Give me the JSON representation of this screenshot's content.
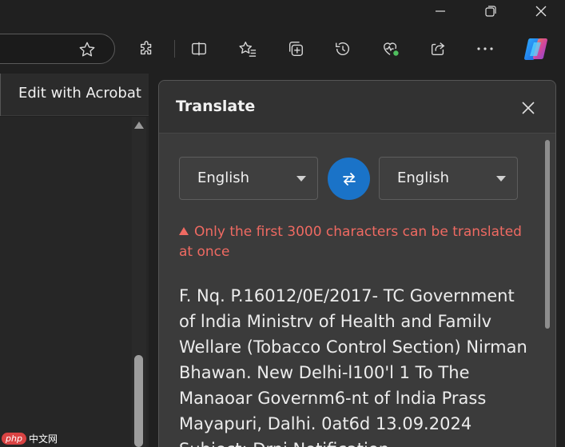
{
  "acrobat": {
    "edit_label": "Edit with Acrobat"
  },
  "translate": {
    "title": "Translate",
    "source_language": "English",
    "target_language": "English",
    "warning": "Only the first 3000 characters can be translated at once",
    "text": "F. Nq. P.16012/0E/2017- TC Government of lndia Ministrv of Health and Familv Wellare (Tobacco Control Section) Nirman Bhawan. New Delhi-l100'l 1 To The Manaoar Governm6-nt of lndia Prass Mayapuri, Dalhi. 0at6d 13.09.2024 Subiect: Drni Notification"
  },
  "watermark": {
    "brand": "php",
    "site": "中文网"
  },
  "colors": {
    "accent": "#1a73c8",
    "warning": "#ef6a62"
  }
}
